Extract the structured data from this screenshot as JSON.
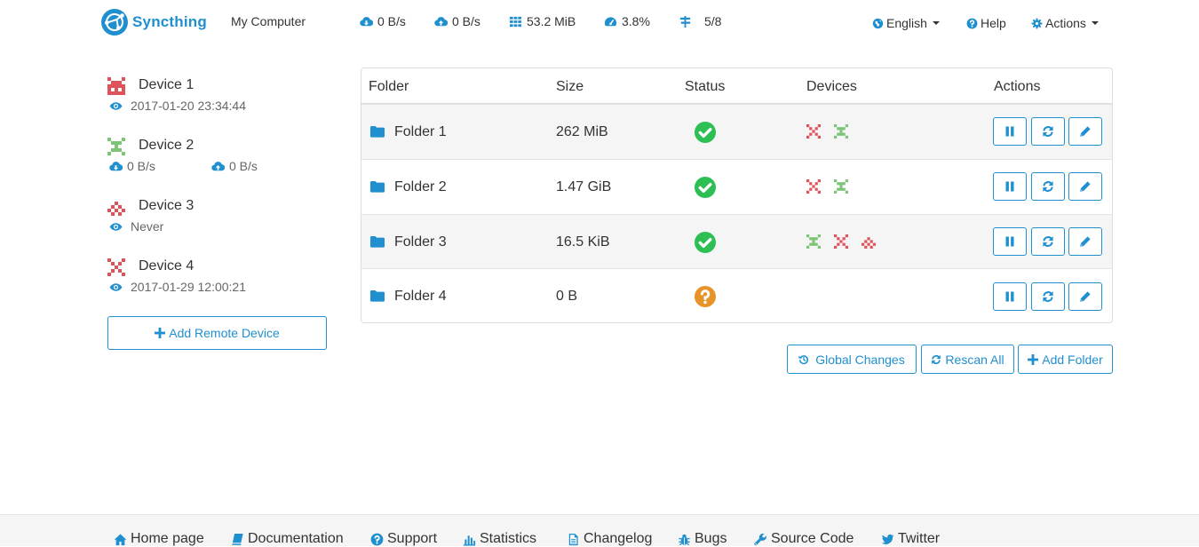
{
  "navbar": {
    "brand": "Syncthing",
    "device_name": "My Computer",
    "stats": {
      "download": "0 B/s",
      "upload": "0 B/s",
      "ram": "53.2 MiB",
      "cpu": "3.8%",
      "connections": "5/8"
    },
    "language": "English",
    "help": "Help",
    "actions": "Actions"
  },
  "devices": [
    {
      "name": "Device 1",
      "status": "2017-01-20 23:34:44",
      "color": "#e0525a"
    },
    {
      "name": "Device 2",
      "download": "0 B/s",
      "upload": "0 B/s",
      "color": "#7cc576"
    },
    {
      "name": "Device 3",
      "status": "Never",
      "color": "#e0525a"
    },
    {
      "name": "Device 4",
      "status": "2017-01-29 12:00:21",
      "color": "#e0525a"
    }
  ],
  "add_device_label": "Add Remote Device",
  "folders": {
    "headers": {
      "folder": "Folder",
      "size": "Size",
      "status": "Status",
      "devices": "Devices",
      "actions": "Actions"
    },
    "rows": [
      {
        "name": "Folder 1",
        "size": "262 MiB",
        "status": "ok",
        "device_icons": [
          "red",
          "green"
        ]
      },
      {
        "name": "Folder 2",
        "size": "1.47 GiB",
        "status": "ok",
        "device_icons": [
          "red",
          "green"
        ]
      },
      {
        "name": "Folder 3",
        "size": "16.5 KiB",
        "status": "ok",
        "device_icons": [
          "green",
          "red",
          "red"
        ]
      },
      {
        "name": "Folder 4",
        "size": "0 B",
        "status": "unknown",
        "device_icons": []
      }
    ]
  },
  "folder_buttons": {
    "global_changes": "Global Changes",
    "rescan_all": "Rescan All",
    "add_folder": "Add Folder"
  },
  "footer": {
    "links": [
      "Home page",
      "Documentation",
      "Support",
      "Statistics",
      "Changelog",
      "Bugs",
      "Source Code",
      "Twitter"
    ]
  },
  "colors": {
    "accent": "#1f8fcf",
    "ok": "#2ebf54",
    "unknown": "#e8922a",
    "identicon_red": "#e0525a",
    "identicon_green": "#7cc576"
  },
  "icons": {
    "download": "cloud-download-icon",
    "upload": "cloud-upload-icon",
    "ram": "grid-icon",
    "cpu": "dashboard-icon",
    "connections": "signpost-icon",
    "language": "globe-icon",
    "help": "question-circle-icon",
    "actions": "gear-icon",
    "last_seen": "eye-icon",
    "folder": "folder-icon",
    "status_ok": "check-circle-icon",
    "status_unknown": "question-circle-icon",
    "pause": "pause-icon",
    "rescan": "refresh-icon",
    "edit": "pencil-icon"
  }
}
